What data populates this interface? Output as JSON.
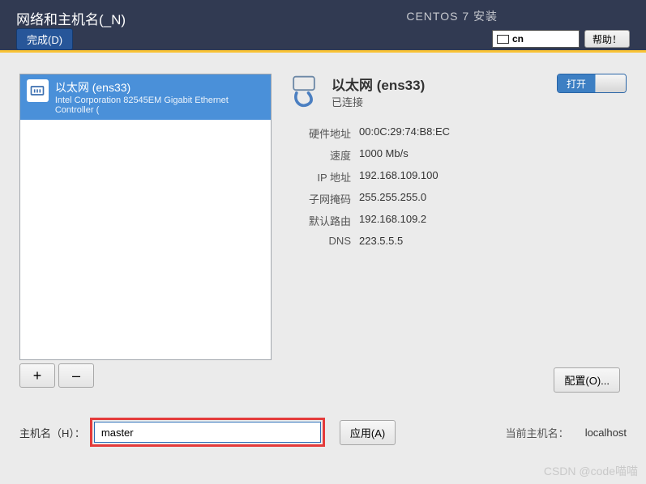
{
  "header": {
    "title": "网络和主机名(_N)",
    "done": "完成(D)",
    "installer_title": "CENTOS 7 安装",
    "lang_code": "cn",
    "help": "帮助！"
  },
  "network_list": {
    "items": [
      {
        "title": "以太网 (ens33)",
        "desc": "Intel Corporation 82545EM Gigabit Ethernet Controller ("
      }
    ],
    "add": "+",
    "remove": "–"
  },
  "details": {
    "name": "以太网 (ens33)",
    "status": "已连接",
    "toggle_label": "打开",
    "rows": [
      {
        "k": "硬件地址",
        "v": "00:0C:29:74:B8:EC"
      },
      {
        "k": "速度",
        "v": "1000 Mb/s"
      },
      {
        "k": "IP 地址",
        "v": "192.168.109.100"
      },
      {
        "k": "子网掩码",
        "v": "255.255.255.0"
      },
      {
        "k": "默认路由",
        "v": "192.168.109.2"
      },
      {
        "k": "DNS",
        "v": "223.5.5.5"
      }
    ],
    "configure": "配置(O)..."
  },
  "hostname": {
    "label": "主机名（H）：",
    "value": "master",
    "apply": "应用(A)",
    "current_label": "当前主机名：",
    "current_value": "localhost"
  },
  "watermark": "CSDN @code喵喵"
}
